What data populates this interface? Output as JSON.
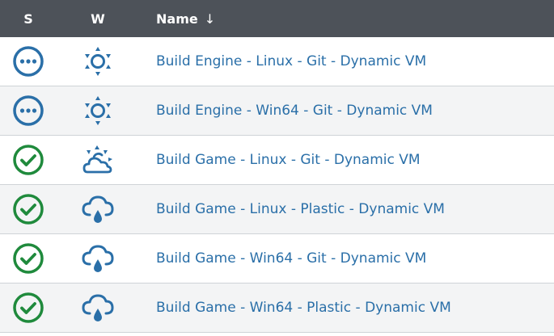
{
  "header": {
    "status_label": "S",
    "weather_label": "W",
    "name_label": "Name",
    "sort_indicator": "↓"
  },
  "colors": {
    "header_bg": "#4d5259",
    "link": "#2a6fa8",
    "status_running": "#2a6fa8",
    "status_success": "#1f8a3c",
    "weather_icon": "#2a6fa8"
  },
  "jobs": [
    {
      "name": "Build Engine - Linux - Git - Dynamic VM",
      "status": "in-progress-icon",
      "weather": "sunny-icon"
    },
    {
      "name": "Build Engine - Win64 - Git - Dynamic VM",
      "status": "in-progress-icon",
      "weather": "sunny-icon"
    },
    {
      "name": "Build Game - Linux - Git - Dynamic VM",
      "status": "success-icon",
      "weather": "partly-cloudy-icon"
    },
    {
      "name": "Build Game - Linux - Plastic - Dynamic VM",
      "status": "success-icon",
      "weather": "rain-cloud-icon"
    },
    {
      "name": "Build Game - Win64 - Git - Dynamic VM",
      "status": "success-icon",
      "weather": "rain-cloud-icon"
    },
    {
      "name": "Build Game - Win64 - Plastic - Dynamic VM",
      "status": "success-icon",
      "weather": "rain-cloud-icon"
    }
  ]
}
